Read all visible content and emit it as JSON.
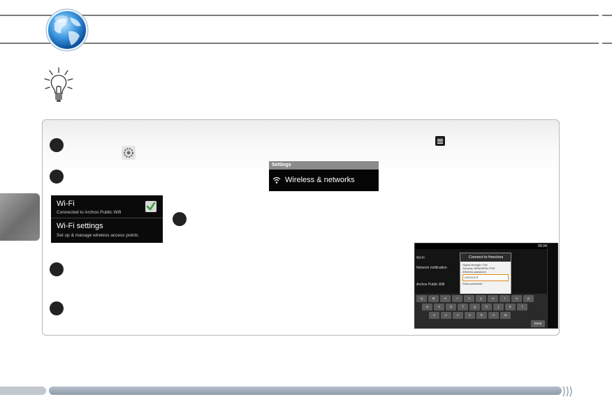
{
  "screenshots": {
    "settings": {
      "title": "Settings",
      "item": "Wireless & networks"
    },
    "wifi_menu": {
      "wifi_label": "Wi-Fi",
      "wifi_status": "Connected to Archos Public Wifi",
      "wifi_settings_label": "Wi-Fi settings",
      "wifi_settings_desc": "Set up & manage wireless access points"
    },
    "tablet": {
      "status_time": "09:34",
      "dialog_title": "Connect to freechos",
      "signal_label": "Signal strength: Fair",
      "security_label": "Security: WPA/WPA2 PSK",
      "wireless_password_label": "Wireless password",
      "password_value": "password",
      "show_password": "Show password",
      "list_wifi": "Wi-Fi",
      "list_notification": "Network notification",
      "list_public": "Archos Public Wifi",
      "keys_row1": [
        "q",
        "w",
        "e",
        "r",
        "t",
        "y",
        "u",
        "i",
        "o",
        "p"
      ],
      "keys_row2": [
        "a",
        "s",
        "d",
        "f",
        "g",
        "h",
        "j",
        "k",
        "l"
      ],
      "keys_row3": [
        "z",
        "x",
        "c",
        "v",
        "b",
        "n",
        "m"
      ],
      "key_done": "Done"
    }
  },
  "colors": {
    "panel_border": "#b9b9b9",
    "rule": "#7a7a7a",
    "check_green": "#3aa232",
    "footer_bar": "#8e9aa7"
  }
}
